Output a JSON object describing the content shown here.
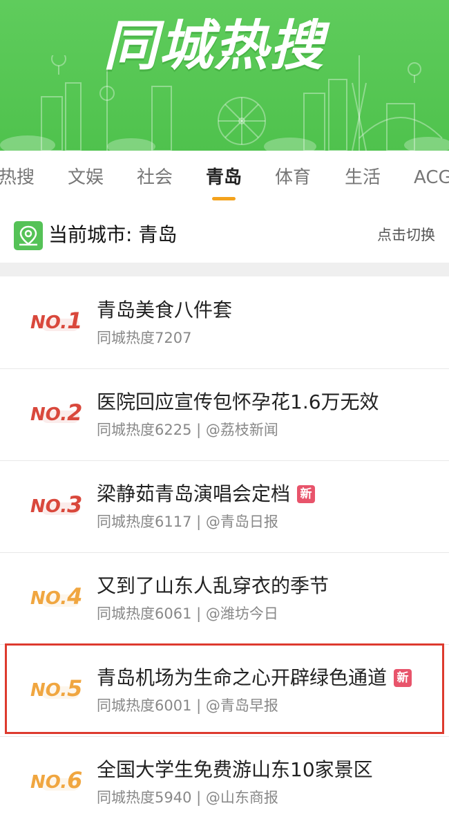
{
  "banner": {
    "title": "同城热搜"
  },
  "tabs": [
    {
      "label": "热搜",
      "active": false
    },
    {
      "label": "文娱",
      "active": false
    },
    {
      "label": "社会",
      "active": false
    },
    {
      "label": "青岛",
      "active": true
    },
    {
      "label": "体育",
      "active": false
    },
    {
      "label": "生活",
      "active": false
    },
    {
      "label": "ACG",
      "active": false
    }
  ],
  "city": {
    "icon": "location-pin-icon",
    "label": "当前城市: 青岛",
    "switch_label": "点击切换"
  },
  "list": [
    {
      "rank_prefix": "NO.",
      "rank_num": "1",
      "title": "青岛美食八件套",
      "sub": "同城热度7207",
      "new_badge": ""
    },
    {
      "rank_prefix": "NO.",
      "rank_num": "2",
      "title": "医院回应宣传包怀孕花1.6万无效",
      "sub": "同城热度6225 | @荔枝新闻",
      "new_badge": ""
    },
    {
      "rank_prefix": "NO.",
      "rank_num": "3",
      "title": "梁静茹青岛演唱会定档",
      "sub": "同城热度6117 | @青岛日报",
      "new_badge": "新"
    },
    {
      "rank_prefix": "NO.",
      "rank_num": "4",
      "title": "又到了山东人乱穿衣的季节",
      "sub": "同城热度6061 | @潍坊今日",
      "new_badge": ""
    },
    {
      "rank_prefix": "NO.",
      "rank_num": "5",
      "title": "青岛机场为生命之心开辟绿色通道",
      "sub": "同城热度6001 | @青岛早报",
      "new_badge": "新"
    },
    {
      "rank_prefix": "NO.",
      "rank_num": "6",
      "title": "全国大学生免费游山东10家景区",
      "sub": "同城热度5940 | @山东商报",
      "new_badge": ""
    }
  ],
  "colors": {
    "brand_green": "#4fc24d",
    "tab_underline": "#f4a21c",
    "rank_top": "#d9483c",
    "rank_other": "#f0a640",
    "new_badge": "#e8546b",
    "highlight": "#dd3a2e"
  }
}
